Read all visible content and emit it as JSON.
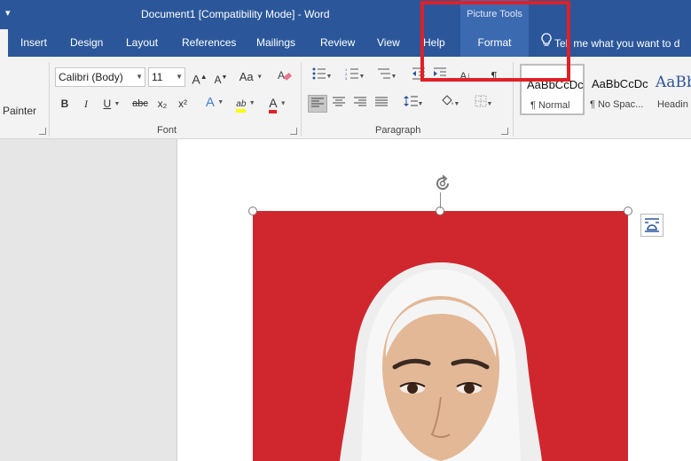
{
  "titlebar": {
    "quick_access": "▾",
    "title": "Document1 [Compatibility Mode]  -  Word",
    "contextual_title": "Picture Tools"
  },
  "tabs": [
    {
      "label": "Insert"
    },
    {
      "label": "Design"
    },
    {
      "label": "Layout"
    },
    {
      "label": "References"
    },
    {
      "label": "Mailings"
    },
    {
      "label": "Review"
    },
    {
      "label": "View"
    },
    {
      "label": "Help"
    },
    {
      "label": "Format"
    }
  ],
  "tellme": {
    "text": "Tell me what you want to d"
  },
  "clipboard": {
    "painter_label": "Painter"
  },
  "font": {
    "group_label": "Font",
    "font_name": "Calibri (Body)",
    "font_size": "11",
    "grow": "A",
    "shrink": "A",
    "change_case": "Aa",
    "bold": "B",
    "italic": "I",
    "underline": "U",
    "strikethrough": "abc",
    "subscript": "x₂",
    "superscript": "x²",
    "text_effects": "A",
    "highlight": "ab",
    "font_color": "A"
  },
  "paragraph": {
    "group_label": "Paragraph",
    "sort": "A",
    "pilcrow": "¶"
  },
  "styles": [
    {
      "sample": "AaBbCcDc",
      "name": "¶ Normal"
    },
    {
      "sample": "AaBbCcDc",
      "name": "¶ No Spac..."
    },
    {
      "sample": "AaBb",
      "name": "Headin"
    }
  ],
  "colors": {
    "ribbon_blue": "#2b579a",
    "format_tab": "#3c6ab1",
    "highlight_box": "#e02027",
    "photo_background": "#d0272e"
  },
  "icons": {
    "rotate": "rotate-handle-icon",
    "layout_options": "layout-options-icon",
    "lightbulb": "lightbulb-icon"
  }
}
